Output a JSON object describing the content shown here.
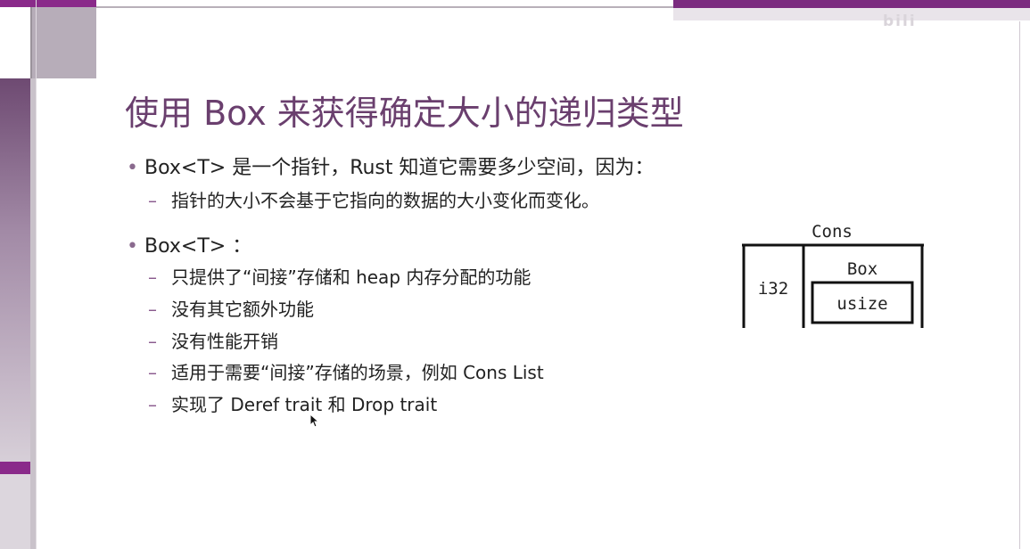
{
  "watermark": "bili",
  "slide": {
    "title": "使用 Box 来获得确定大小的递归类型",
    "bullet1": "Box<T> 是一个指针，Rust 知道它需要多少空间，因为：",
    "bullet1_sub": [
      "指针的大小不会基于它指向的数据的大小变化而变化。"
    ],
    "bullet2": "Box<T> ：",
    "bullet2_sub": [
      "只提供了“间接”存储和 heap 内存分配的功能",
      "没有其它额外功能",
      "没有性能开销",
      "适用于需要“间接”存储的场景，例如 Cons List",
      "实现了 Deref trait 和 Drop trait"
    ]
  },
  "diagram": {
    "cons_label": "Cons",
    "i32_label": "i32",
    "box_label": "Box",
    "usize_label": "usize"
  },
  "colors": {
    "accent": "#7b2b7f",
    "title": "#6a3f6e"
  }
}
